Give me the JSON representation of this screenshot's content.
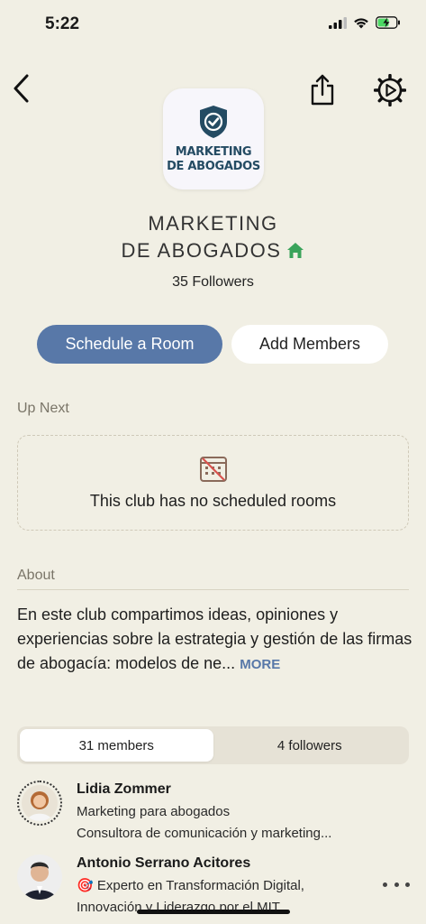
{
  "status_bar": {
    "time": "5:22"
  },
  "club": {
    "logo_line1": "MARKETING",
    "logo_line2": "DE ABOGADOS",
    "title_line1": "MARKETING",
    "title_line2": "DE ABOGADOS",
    "followers": "35 Followers"
  },
  "actions": {
    "schedule_room": "Schedule a Room",
    "add_members": "Add Members"
  },
  "up_next": {
    "label": "Up Next",
    "empty_text": "This club has no scheduled rooms"
  },
  "about": {
    "label": "About",
    "text": "En este club compartimos ideas, opiniones y experiencias sobre la estrategia y gestión de las firmas de abogacía: modelos de ne...",
    "more": "MORE"
  },
  "tabs": [
    {
      "label": "31 members",
      "active": true
    },
    {
      "label": "4 followers",
      "active": false
    }
  ],
  "members": [
    {
      "name": "Lidia Zommer",
      "bio_line1": "Marketing para abogados",
      "bio_line2": "Consultora de comunicación y marketing..."
    },
    {
      "name": "Antonio Serrano Acitores",
      "bio_line1": "🎯 Experto en Transformación Digital,",
      "bio_line2": "Innovación y Liderazgo por el MIT..."
    }
  ],
  "colors": {
    "background": "#f1efe4",
    "primary_button": "#5878a8",
    "accent_green": "#3aa35a",
    "logo_blue": "#244b63"
  }
}
